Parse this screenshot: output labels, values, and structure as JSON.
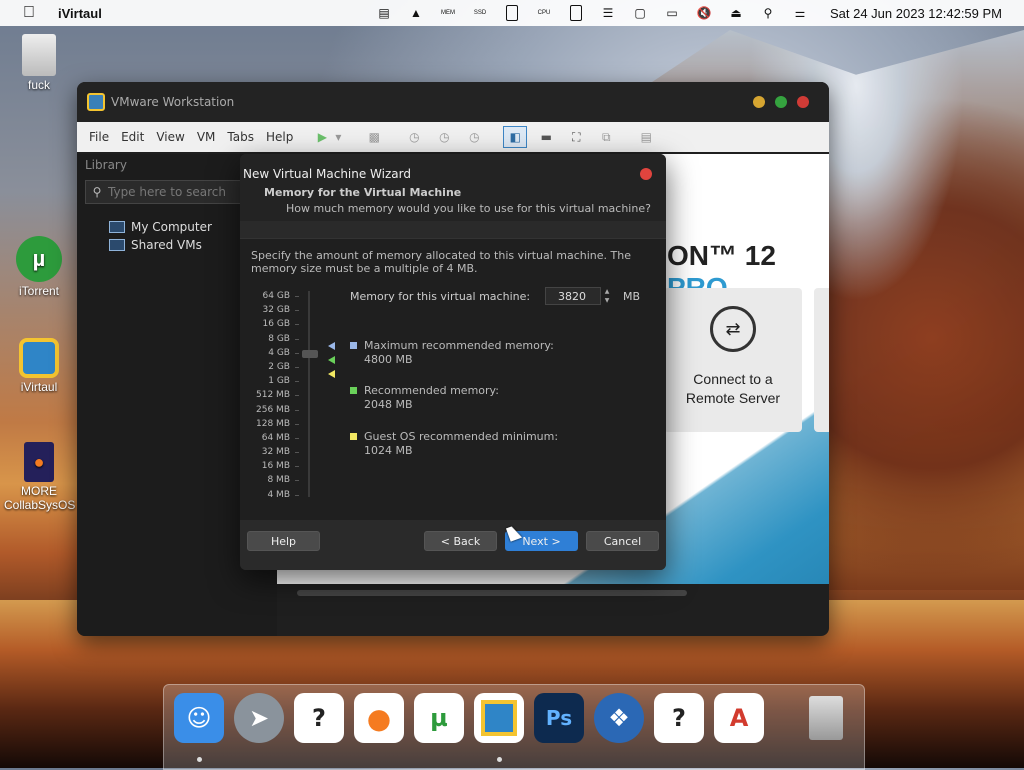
{
  "menubar": {
    "apple_icon": "apple-icon",
    "app_name": "iVirtaul",
    "status_icons": [
      "display-icon",
      "eject-circle-icon",
      "mem-meter-icon",
      "ssd-meter-icon",
      "phone-icon",
      "cpu-meter-icon",
      "battery-icon",
      "list-icon",
      "window-icon",
      "monitor-icon",
      "mute-icon",
      "eject-icon",
      "search-icon",
      "control-center-icon"
    ],
    "mem_label": "MEM",
    "ssd_label": "SSD",
    "cpu_label": "CPU",
    "clock": "Sat 24 Jun 2023  12:42:59 PM"
  },
  "desktop": {
    "icons": [
      {
        "label": "fuck"
      },
      {
        "label": "iTorrent"
      },
      {
        "label": "iVirtaul"
      },
      {
        "label": "MORE CollabSysOS"
      }
    ]
  },
  "vmware": {
    "title": "VMware Workstation",
    "menu": [
      "File",
      "Edit",
      "View",
      "VM",
      "Tabs",
      "Help"
    ],
    "library_label": "Library",
    "search_placeholder": "Type here to search",
    "tree": [
      "My Computer",
      "Shared VMs"
    ],
    "brand": "ON™ 12 ",
    "brand_pro": "PRO",
    "tile_label": "Connect to a Remote Server"
  },
  "wizard": {
    "title": "New Virtual Machine Wizard",
    "heading": "Memory for the Virtual Machine",
    "subheading": "How much memory would you like to use for this virtual machine?",
    "description": "Specify the amount of memory allocated to this virtual machine. The memory size must be a multiple of 4 MB.",
    "scale": [
      "64 GB",
      "32 GB",
      "16 GB",
      "8 GB",
      "4 GB",
      "2 GB",
      "1 GB",
      "512 MB",
      "256 MB",
      "128 MB",
      "64 MB",
      "32 MB",
      "16 MB",
      "8 MB",
      "4 MB"
    ],
    "memory_label": "Memory for this virtual machine:",
    "memory_value": "3820",
    "memory_unit": "MB",
    "legend": [
      {
        "label": "Maximum recommended memory:",
        "value": "4800 MB",
        "color": "#9ab7e8"
      },
      {
        "label": "Recommended memory:",
        "value": "2048 MB",
        "color": "#6ad15a"
      },
      {
        "label": "Guest OS recommended minimum:",
        "value": "1024 MB",
        "color": "#f2e862"
      }
    ],
    "buttons": {
      "help": "Help",
      "back": "< Back",
      "next": "Next >",
      "cancel": "Cancel"
    }
  },
  "dock": {
    "apps": [
      "finder-icon",
      "launchpad-icon",
      "unknown-app-icon",
      "firefox-icon",
      "utorrent-icon",
      "vmware-icon",
      "photoshop-icon",
      "windows-icon",
      "unknown-app-icon",
      "text-editor-icon",
      "trash-icon"
    ],
    "ps_label": "Ps"
  }
}
